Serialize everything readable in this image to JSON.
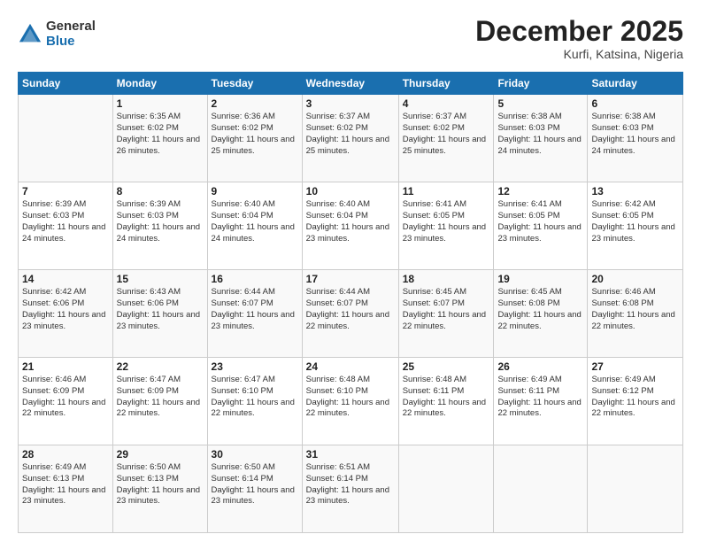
{
  "logo": {
    "general": "General",
    "blue": "Blue"
  },
  "title": "December 2025",
  "subtitle": "Kurfi, Katsina, Nigeria",
  "days_of_week": [
    "Sunday",
    "Monday",
    "Tuesday",
    "Wednesday",
    "Thursday",
    "Friday",
    "Saturday"
  ],
  "weeks": [
    [
      {
        "day": "",
        "info": ""
      },
      {
        "day": "1",
        "info": "Sunrise: 6:35 AM\nSunset: 6:02 PM\nDaylight: 11 hours and 26 minutes."
      },
      {
        "day": "2",
        "info": "Sunrise: 6:36 AM\nSunset: 6:02 PM\nDaylight: 11 hours and 25 minutes."
      },
      {
        "day": "3",
        "info": "Sunrise: 6:37 AM\nSunset: 6:02 PM\nDaylight: 11 hours and 25 minutes."
      },
      {
        "day": "4",
        "info": "Sunrise: 6:37 AM\nSunset: 6:02 PM\nDaylight: 11 hours and 25 minutes."
      },
      {
        "day": "5",
        "info": "Sunrise: 6:38 AM\nSunset: 6:03 PM\nDaylight: 11 hours and 24 minutes."
      },
      {
        "day": "6",
        "info": "Sunrise: 6:38 AM\nSunset: 6:03 PM\nDaylight: 11 hours and 24 minutes."
      }
    ],
    [
      {
        "day": "7",
        "info": "Sunrise: 6:39 AM\nSunset: 6:03 PM\nDaylight: 11 hours and 24 minutes."
      },
      {
        "day": "8",
        "info": "Sunrise: 6:39 AM\nSunset: 6:03 PM\nDaylight: 11 hours and 24 minutes."
      },
      {
        "day": "9",
        "info": "Sunrise: 6:40 AM\nSunset: 6:04 PM\nDaylight: 11 hours and 24 minutes."
      },
      {
        "day": "10",
        "info": "Sunrise: 6:40 AM\nSunset: 6:04 PM\nDaylight: 11 hours and 23 minutes."
      },
      {
        "day": "11",
        "info": "Sunrise: 6:41 AM\nSunset: 6:05 PM\nDaylight: 11 hours and 23 minutes."
      },
      {
        "day": "12",
        "info": "Sunrise: 6:41 AM\nSunset: 6:05 PM\nDaylight: 11 hours and 23 minutes."
      },
      {
        "day": "13",
        "info": "Sunrise: 6:42 AM\nSunset: 6:05 PM\nDaylight: 11 hours and 23 minutes."
      }
    ],
    [
      {
        "day": "14",
        "info": "Sunrise: 6:42 AM\nSunset: 6:06 PM\nDaylight: 11 hours and 23 minutes."
      },
      {
        "day": "15",
        "info": "Sunrise: 6:43 AM\nSunset: 6:06 PM\nDaylight: 11 hours and 23 minutes."
      },
      {
        "day": "16",
        "info": "Sunrise: 6:44 AM\nSunset: 6:07 PM\nDaylight: 11 hours and 23 minutes."
      },
      {
        "day": "17",
        "info": "Sunrise: 6:44 AM\nSunset: 6:07 PM\nDaylight: 11 hours and 22 minutes."
      },
      {
        "day": "18",
        "info": "Sunrise: 6:45 AM\nSunset: 6:07 PM\nDaylight: 11 hours and 22 minutes."
      },
      {
        "day": "19",
        "info": "Sunrise: 6:45 AM\nSunset: 6:08 PM\nDaylight: 11 hours and 22 minutes."
      },
      {
        "day": "20",
        "info": "Sunrise: 6:46 AM\nSunset: 6:08 PM\nDaylight: 11 hours and 22 minutes."
      }
    ],
    [
      {
        "day": "21",
        "info": "Sunrise: 6:46 AM\nSunset: 6:09 PM\nDaylight: 11 hours and 22 minutes."
      },
      {
        "day": "22",
        "info": "Sunrise: 6:47 AM\nSunset: 6:09 PM\nDaylight: 11 hours and 22 minutes."
      },
      {
        "day": "23",
        "info": "Sunrise: 6:47 AM\nSunset: 6:10 PM\nDaylight: 11 hours and 22 minutes."
      },
      {
        "day": "24",
        "info": "Sunrise: 6:48 AM\nSunset: 6:10 PM\nDaylight: 11 hours and 22 minutes."
      },
      {
        "day": "25",
        "info": "Sunrise: 6:48 AM\nSunset: 6:11 PM\nDaylight: 11 hours and 22 minutes."
      },
      {
        "day": "26",
        "info": "Sunrise: 6:49 AM\nSunset: 6:11 PM\nDaylight: 11 hours and 22 minutes."
      },
      {
        "day": "27",
        "info": "Sunrise: 6:49 AM\nSunset: 6:12 PM\nDaylight: 11 hours and 22 minutes."
      }
    ],
    [
      {
        "day": "28",
        "info": "Sunrise: 6:49 AM\nSunset: 6:13 PM\nDaylight: 11 hours and 23 minutes."
      },
      {
        "day": "29",
        "info": "Sunrise: 6:50 AM\nSunset: 6:13 PM\nDaylight: 11 hours and 23 minutes."
      },
      {
        "day": "30",
        "info": "Sunrise: 6:50 AM\nSunset: 6:14 PM\nDaylight: 11 hours and 23 minutes."
      },
      {
        "day": "31",
        "info": "Sunrise: 6:51 AM\nSunset: 6:14 PM\nDaylight: 11 hours and 23 minutes."
      },
      {
        "day": "",
        "info": ""
      },
      {
        "day": "",
        "info": ""
      },
      {
        "day": "",
        "info": ""
      }
    ]
  ]
}
